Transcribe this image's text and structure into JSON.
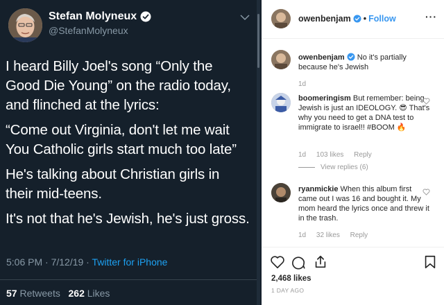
{
  "tweet": {
    "display_name": "Stefan Molyneux",
    "handle": "@StefanMolyneux",
    "paragraphs": [
      "I heard Billy Joel's song “Only the Good Die Young” on the radio today, and flinched at the lyrics:",
      "“Come out Virginia, don't let me wait You Catholic girls start much too late”",
      "He's talking about Christian girls in their mid-teens.",
      "It's not that he's Jewish, he's just gross."
    ],
    "time": "5:06 PM · 7/12/19 · ",
    "source": "Twitter for iPhone",
    "retweets_count": "57",
    "retweets_label": "Retweets",
    "likes_count": "262",
    "likes_label": "Likes"
  },
  "instagram": {
    "poster": "owenbenjam",
    "separator": "•",
    "follow_label": "Follow",
    "more_label": "···",
    "comments": [
      {
        "user": "owenbenjam",
        "text": "No it's partially because he's Jewish",
        "age": "1d",
        "likes": "",
        "reply": ""
      },
      {
        "user": "boomeringism",
        "text": "But remember: being Jewish is just an IDEOLOGY. 😎 That's why you need to get a DNA test to immigrate to israel!! #BOOM 🔥",
        "age": "1d",
        "likes": "103 likes",
        "reply": "Reply",
        "view_replies": "View replies (6)"
      },
      {
        "user": "ryanmickie",
        "text": "When this album first came out I was 16 and bought it. My mom heard the lyrics once and threw it in the trash.",
        "age": "1d",
        "likes": "32 likes",
        "reply": "Reply"
      }
    ],
    "likes_total": "2,468 likes",
    "posted_ago": "1 DAY AGO"
  },
  "colors": {
    "twitter_bg": "#15202b",
    "twitter_blue": "#1da1f2",
    "twitter_muted": "#8899a6",
    "instagram_link": "#3897f0",
    "instagram_text": "#262626"
  }
}
